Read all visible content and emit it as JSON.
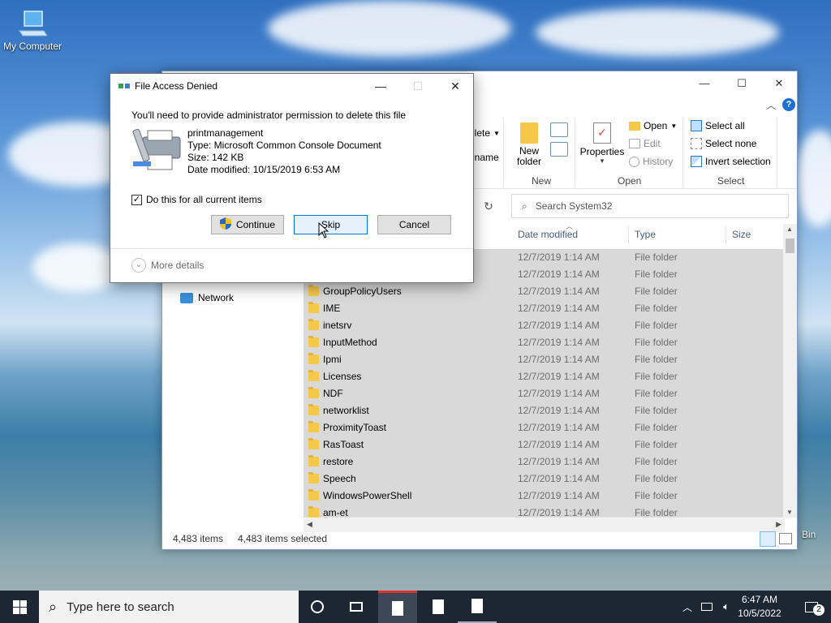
{
  "desktop": {
    "icons": [
      {
        "label": "My Computer"
      },
      {
        "label": "Bin"
      }
    ]
  },
  "explorer": {
    "ribbon": {
      "organize": {
        "delete_label": "elete",
        "rename_label": "ename"
      },
      "new": {
        "new_folder_label": "New folder",
        "group_label": "New"
      },
      "open": {
        "properties_label": "Properties",
        "open_label": "Open",
        "edit_label": "Edit",
        "history_label": "History",
        "group_label": "Open"
      },
      "select": {
        "select_all_label": "Select all",
        "select_none_label": "Select none",
        "invert_label": "Invert selection",
        "group_label": "Select"
      }
    },
    "search": {
      "placeholder": "Search System32"
    },
    "columns": {
      "date": "Date modified",
      "type": "Type",
      "size": "Size"
    },
    "nav": {
      "network_label": "Network"
    },
    "rows": [
      {
        "name": "",
        "date": "12/7/2019 1:14 AM",
        "type": "File folder"
      },
      {
        "name": "",
        "date": "12/7/2019 1:14 AM",
        "type": "File folder"
      },
      {
        "name": "GroupPolicyUsers",
        "date": "12/7/2019 1:14 AM",
        "type": "File folder"
      },
      {
        "name": "IME",
        "date": "12/7/2019 1:14 AM",
        "type": "File folder"
      },
      {
        "name": "inetsrv",
        "date": "12/7/2019 1:14 AM",
        "type": "File folder"
      },
      {
        "name": "InputMethod",
        "date": "12/7/2019 1:14 AM",
        "type": "File folder"
      },
      {
        "name": "Ipmi",
        "date": "12/7/2019 1:14 AM",
        "type": "File folder"
      },
      {
        "name": "Licenses",
        "date": "12/7/2019 1:14 AM",
        "type": "File folder"
      },
      {
        "name": "NDF",
        "date": "12/7/2019 1:14 AM",
        "type": "File folder"
      },
      {
        "name": "networklist",
        "date": "12/7/2019 1:14 AM",
        "type": "File folder"
      },
      {
        "name": "ProximityToast",
        "date": "12/7/2019 1:14 AM",
        "type": "File folder"
      },
      {
        "name": "RasToast",
        "date": "12/7/2019 1:14 AM",
        "type": "File folder"
      },
      {
        "name": "restore",
        "date": "12/7/2019 1:14 AM",
        "type": "File folder"
      },
      {
        "name": "Speech",
        "date": "12/7/2019 1:14 AM",
        "type": "File folder"
      },
      {
        "name": "WindowsPowerShell",
        "date": "12/7/2019 1:14 AM",
        "type": "File folder"
      },
      {
        "name": "am-et",
        "date": "12/7/2019 1:14 AM",
        "type": "File folder"
      }
    ],
    "status": {
      "items": "4,483 items",
      "selected": "4,483 items selected"
    }
  },
  "dialog": {
    "title": "File Access Denied",
    "message": "You'll need to provide administrator permission to delete this file",
    "file": {
      "name": "printmanagement",
      "type": "Type: Microsoft Common Console Document",
      "size": "Size: 142 KB",
      "modified": "Date modified: 10/15/2019 6:53 AM"
    },
    "checkbox_label": "Do this for all current items",
    "continue_label": "Continue",
    "skip_label": "Skip",
    "cancel_label": "Cancel",
    "more_details_label": "More details"
  },
  "taskbar": {
    "search_placeholder": "Type here to search",
    "time": "6:47 AM",
    "date": "10/5/2022",
    "notification_count": "2"
  },
  "colors": {
    "selection_row": "#d9d9d9",
    "accent_blue": "#0078d7",
    "taskbar": "#1c2733"
  }
}
